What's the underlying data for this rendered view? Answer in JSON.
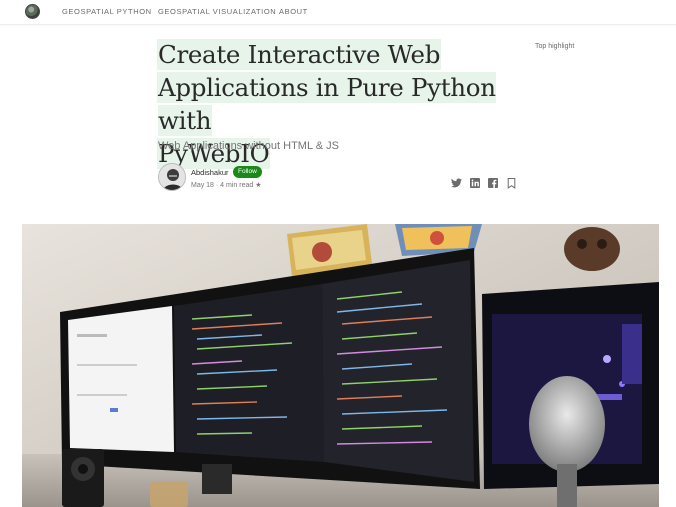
{
  "nav": {
    "items": [
      "GEOSPATIAL PYTHON",
      "GEOSPATIAL VISUALIZATION",
      "ABOUT"
    ]
  },
  "article": {
    "title_lines": [
      "Create Interactive Web",
      "Applications in Pure Python with",
      "PyWebIO"
    ],
    "subtitle": "Web Applications without HTML & JS",
    "top_highlight": "Top highlight",
    "author": "Abdishakur",
    "follow_label": "Follow",
    "meta": "May 18 · 4 min read ★"
  },
  "share": {
    "icons": [
      "twitter-icon",
      "linkedin-icon",
      "facebook-icon",
      "bookmark-icon"
    ]
  },
  "colors": {
    "accent": "#1a8917",
    "highlight": "#e6f4ea",
    "text": "#292929",
    "muted": "#757575"
  }
}
